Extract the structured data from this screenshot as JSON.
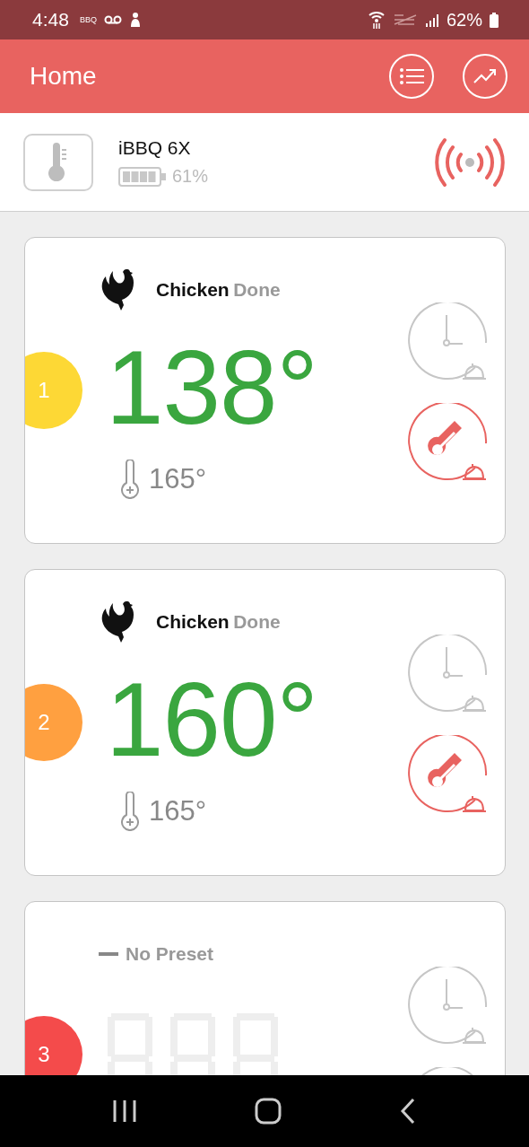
{
  "status_bar": {
    "time": "4:48",
    "notification": "BBQ",
    "battery": "62%"
  },
  "header": {
    "title": "Home"
  },
  "device": {
    "name": "iBBQ 6X",
    "battery": "61%",
    "connected": true
  },
  "probes": [
    {
      "number": "1",
      "color": "#fdd835",
      "preset": {
        "kind": "food",
        "name": "Chicken",
        "status": "Done"
      },
      "temperature": "138°",
      "target": "165°",
      "timer_alarm": false,
      "temp_alarm": true
    },
    {
      "number": "2",
      "color": "#ffa040",
      "preset": {
        "kind": "food",
        "name": "Chicken",
        "status": "Done"
      },
      "temperature": "160°",
      "target": "165°",
      "timer_alarm": false,
      "temp_alarm": true
    },
    {
      "number": "3",
      "color": "#f44b4b",
      "preset": {
        "kind": "none",
        "name": "No Preset"
      },
      "timer_alarm": false,
      "temp_alarm": false
    }
  ]
}
